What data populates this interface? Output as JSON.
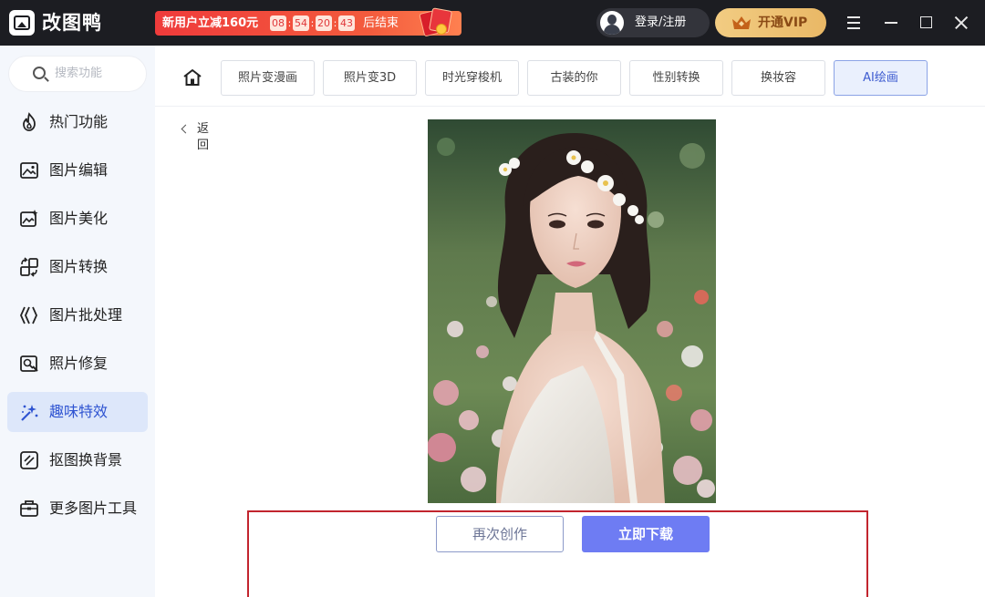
{
  "app": {
    "title": "改图鸭"
  },
  "promo": {
    "text": "新用户立减160元",
    "countdown": [
      "08",
      "54",
      "20",
      "43"
    ],
    "suffix": "后结束"
  },
  "header": {
    "login_label": "登录/注册",
    "vip_label": "开通VIP"
  },
  "sidebar": {
    "search_placeholder": "搜索功能",
    "items": [
      {
        "label": "热门功能",
        "icon": "flame-icon"
      },
      {
        "label": "图片编辑",
        "icon": "image-edit-icon"
      },
      {
        "label": "图片美化",
        "icon": "image-beautify-icon"
      },
      {
        "label": "图片转换",
        "icon": "convert-icon"
      },
      {
        "label": "图片批处理",
        "icon": "batch-icon"
      },
      {
        "label": "照片修复",
        "icon": "photo-repair-icon"
      },
      {
        "label": "趣味特效",
        "icon": "sparkle-icon",
        "active": true
      },
      {
        "label": "抠图换背景",
        "icon": "cutout-icon"
      },
      {
        "label": "更多图片工具",
        "icon": "toolbox-icon"
      }
    ]
  },
  "tabs": [
    {
      "label": "照片变漫画"
    },
    {
      "label": "照片变3D"
    },
    {
      "label": "时光穿梭机"
    },
    {
      "label": "古装的你"
    },
    {
      "label": "性别转换"
    },
    {
      "label": "换妆容"
    },
    {
      "label": "AI绘画",
      "active": true
    }
  ],
  "content": {
    "back_label": "返回",
    "again_label": "再次创作",
    "download_label": "立即下载"
  },
  "colors": {
    "titlebar": "#1c1d22",
    "promo": "#ef3b3b",
    "vip": "#e9b866",
    "sidebar_bg": "#f4f7fc",
    "sidebar_active": "#dde7fa",
    "accent": "#6e7cf3",
    "frame": "#c2252e"
  }
}
